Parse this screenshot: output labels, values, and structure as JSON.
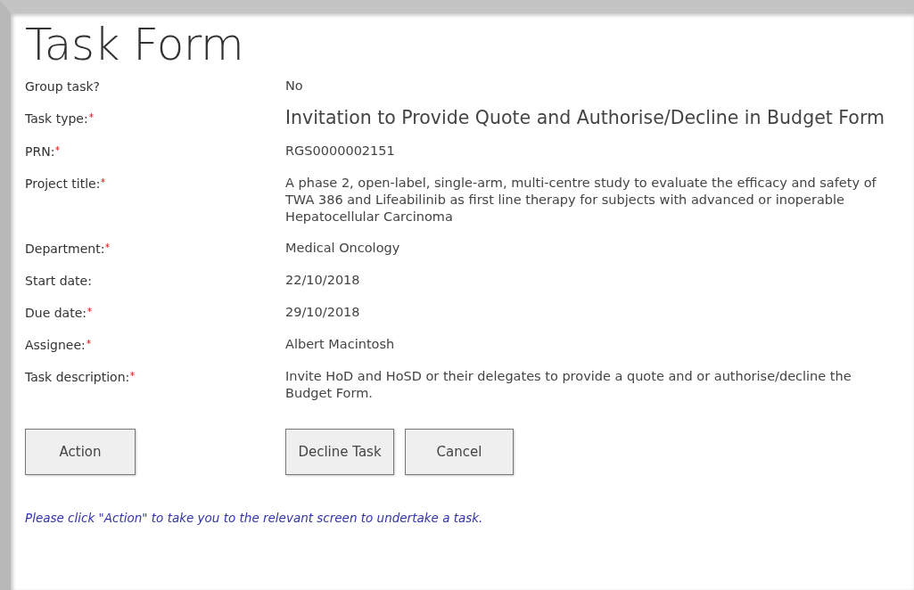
{
  "title": "Task Form",
  "fields": [
    {
      "label": "Group task?",
      "required": false,
      "value": "No",
      "kind": "plain"
    },
    {
      "label": "Task type:",
      "required": true,
      "value": "Invitation to Provide Quote and Authorise/Decline in Budget Form",
      "kind": "large"
    },
    {
      "label": "PRN:",
      "required": true,
      "value": "RGS0000002151",
      "kind": "plain"
    },
    {
      "label": "Project title:",
      "required": true,
      "value": "A phase 2, open-label, single-arm, multi-centre study to evaluate the efficacy and safety of TWA 386 and Lifeabilinib as first line therapy for subjects with advanced or inoperable Hepatocellular Carcinoma",
      "kind": "plain"
    },
    {
      "label": "Department:",
      "required": true,
      "value": "Medical Oncology",
      "kind": "plain"
    },
    {
      "label": "Start date:",
      "required": false,
      "value": "22/10/2018",
      "kind": "plain"
    },
    {
      "label": "Due date:",
      "required": true,
      "value": "29/10/2018",
      "kind": "plain"
    },
    {
      "label": "Assignee:",
      "required": true,
      "value": "Albert Macintosh",
      "kind": "plain"
    },
    {
      "label": "Task description:",
      "required": true,
      "value": "Invite HoD and HoSD or their delegates to provide a quote and or authorise/decline the Budget Form.",
      "kind": "plain"
    }
  ],
  "primary_button": "Action",
  "buttons": [
    "Decline Task",
    "Cancel"
  ],
  "note": "Please click \"Action\" to take you to the relevant screen to undertake a task."
}
